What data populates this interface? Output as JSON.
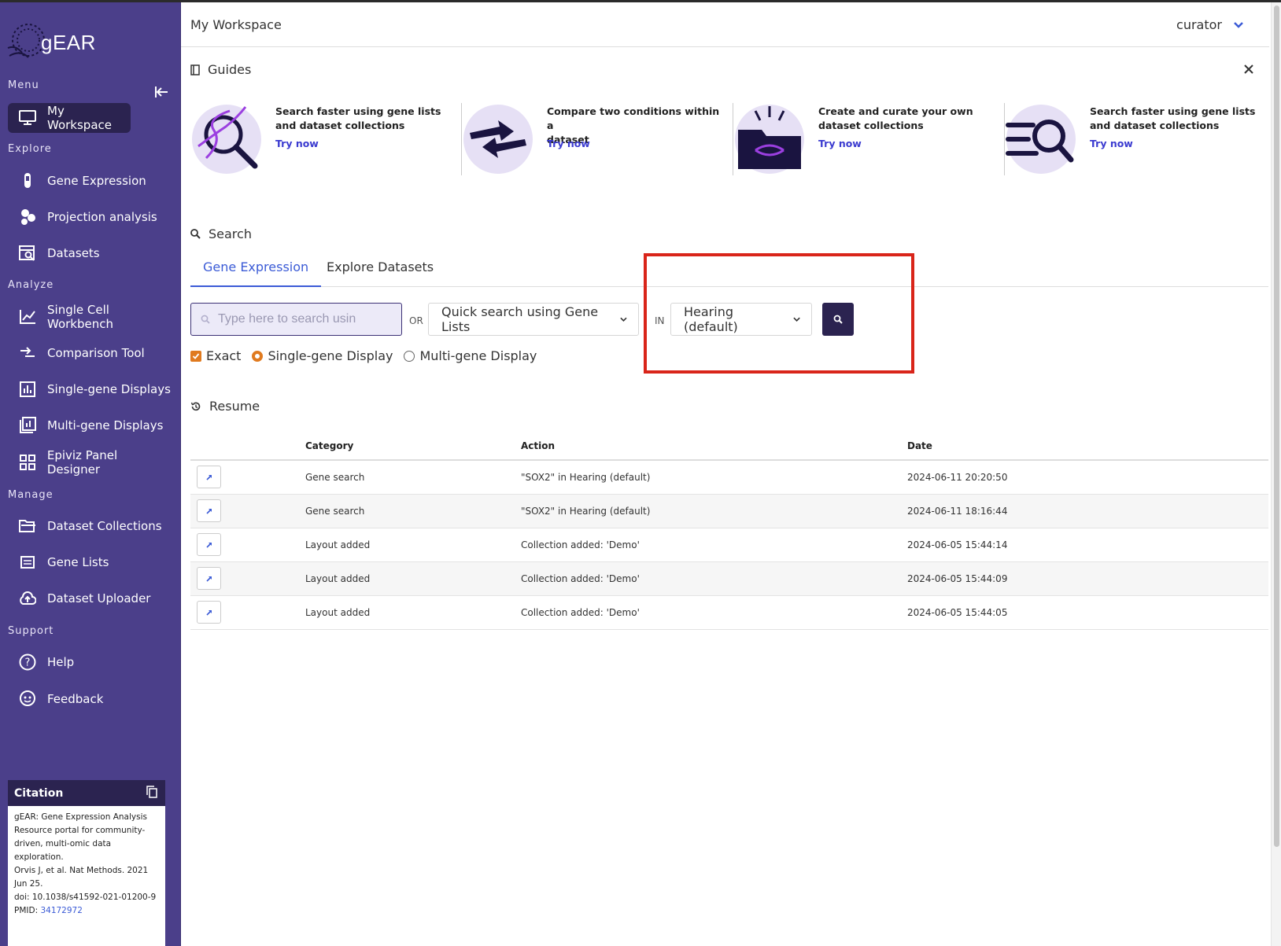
{
  "app": {
    "logo_text": "gEAR"
  },
  "sidebar": {
    "menu_label": "Menu",
    "sections": {
      "explore": "Explore",
      "analyze": "Analyze",
      "manage": "Manage",
      "support": "Support"
    },
    "items": {
      "workspace": "My Workspace",
      "gene_expression": "Gene Expression",
      "projection": "Projection analysis",
      "datasets": "Datasets",
      "single_cell": "Single Cell Workbench",
      "comparison": "Comparison Tool",
      "single_gene": "Single-gene Displays",
      "multi_gene": "Multi-gene Displays",
      "epiviz": "Epiviz Panel Designer",
      "collections": "Dataset Collections",
      "gene_lists": "Gene Lists",
      "uploader": "Dataset Uploader",
      "help": "Help",
      "feedback": "Feedback"
    },
    "citation": {
      "title": "Citation",
      "lines": [
        "gEAR: Gene Expression Analysis",
        "Resource portal for community-",
        "driven, multi-omic data",
        "exploration.",
        "Orvis J, et al. Nat Methods. 2021",
        "Jun 25.",
        "doi: 10.1038/s41592-021-01200-9"
      ],
      "pmid_label": "PMID: ",
      "pmid": "34172972"
    }
  },
  "header": {
    "title": "My Workspace",
    "user": "curator"
  },
  "guides": {
    "title": "Guides",
    "try_label": "Try now",
    "cards": [
      {
        "line1": "Search faster using gene lists",
        "line2": "and dataset collections",
        "icon": "dna-magnifier-icon"
      },
      {
        "line1": "Compare two conditions within a",
        "line2": "dataset",
        "icon": "compare-arrows-icon"
      },
      {
        "line1": "Create and curate your own",
        "line2": "dataset collections",
        "icon": "dna-folder-icon"
      },
      {
        "line1": "Search faster using gene lists",
        "line2": "and dataset collections",
        "icon": "list-search-icon"
      }
    ]
  },
  "search": {
    "title": "Search",
    "tabs": [
      "Gene Expression",
      "Explore Datasets"
    ],
    "placeholder": "Type here to search usin",
    "or_label": "OR",
    "gene_list_dropdown": "Quick search using Gene Lists",
    "in_label": "IN",
    "collection_dropdown": "Hearing (default)",
    "options": {
      "exact": "Exact",
      "single": "Single-gene Display",
      "multi": "Multi-gene Display"
    }
  },
  "resume": {
    "title": "Resume",
    "columns": [
      "Category",
      "Action",
      "Date"
    ],
    "rows": [
      {
        "category": "Gene search",
        "action": "\"SOX2\" in Hearing (default)",
        "date": "2024-06-11 20:20:50"
      },
      {
        "category": "Gene search",
        "action": "\"SOX2\" in Hearing (default)",
        "date": "2024-06-11 18:16:44"
      },
      {
        "category": "Layout added",
        "action": "Collection added: 'Demo'",
        "date": "2024-06-05 15:44:14"
      },
      {
        "category": "Layout added",
        "action": "Collection added: 'Demo'",
        "date": "2024-06-05 15:44:09"
      },
      {
        "category": "Layout added",
        "action": "Collection added: 'Demo'",
        "date": "2024-06-05 15:44:05"
      }
    ]
  },
  "colors": {
    "sidebar_bg": "#4b3f8a",
    "primary_dark": "#2b2350",
    "link_blue": "#3b5bd6",
    "highlight_red": "#d9251a",
    "accent_orange": "#e07a1f"
  }
}
